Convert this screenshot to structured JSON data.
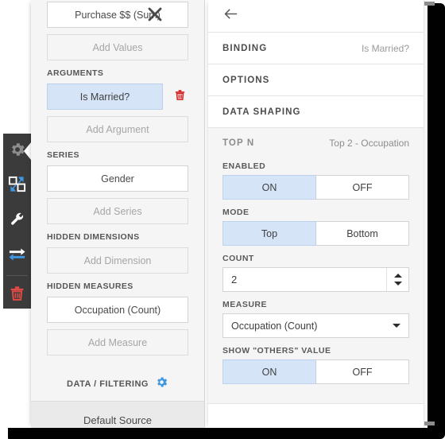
{
  "icon_rail": {
    "items": [
      {
        "name": "gear-icon",
        "label": "Options",
        "selected": true
      },
      {
        "name": "swap-panels-icon",
        "label": "Swap",
        "selected": false
      },
      {
        "name": "wrench-icon",
        "label": "Tools",
        "selected": false
      },
      {
        "name": "transpose-arrows-icon",
        "label": "Transpose",
        "selected": false
      },
      {
        "name": "trash-icon",
        "label": "Delete",
        "selected": false
      }
    ]
  },
  "left_panel": {
    "values_field": "Purchase $$ (Sum)",
    "add_values_label": "Add Values",
    "close_label": "×",
    "arguments_header": "ARGUMENTS",
    "argument_field": "Is Married?",
    "add_argument_label": "Add Argument",
    "series_header": "SERIES",
    "series_field": "Gender",
    "add_series_label": "Add Series",
    "hidden_dimensions_header": "HIDDEN DIMENSIONS",
    "add_dimension_label": "Add Dimension",
    "hidden_measures_header": "HIDDEN MEASURES",
    "hidden_measure_field": "Occupation (Count)",
    "add_measure_label": "Add Measure",
    "data_filtering_label": "DATA / FILTERING",
    "default_source_label": "Default Source"
  },
  "right_panel": {
    "back_label": "←",
    "rows": [
      {
        "key": "BINDING",
        "value": "Is Married?"
      },
      {
        "key": "OPTIONS",
        "value": ""
      },
      {
        "key": "DATA SHAPING",
        "value": ""
      }
    ],
    "top_n": {
      "header_key": "TOP N",
      "header_value": "Top 2 - Occupation",
      "enabled_label": "ENABLED",
      "enabled_options": [
        "ON",
        "OFF"
      ],
      "enabled_selected": "ON",
      "mode_label": "MODE",
      "mode_options": [
        "Top",
        "Bottom"
      ],
      "mode_selected": "Top",
      "count_label": "COUNT",
      "count_value": "2",
      "measure_label": "MEASURE",
      "measure_value": "Occupation (Count)",
      "show_others_label": "SHOW \"OTHERS\" VALUE",
      "show_others_options": [
        "ON",
        "OFF"
      ],
      "show_others_selected": "ON"
    }
  },
  "colors": {
    "accent_blue": "#3e97e0",
    "selected_fill": "#d6e4f7",
    "danger_red": "#e04b46",
    "rail_bg": "#3b3b3b"
  }
}
